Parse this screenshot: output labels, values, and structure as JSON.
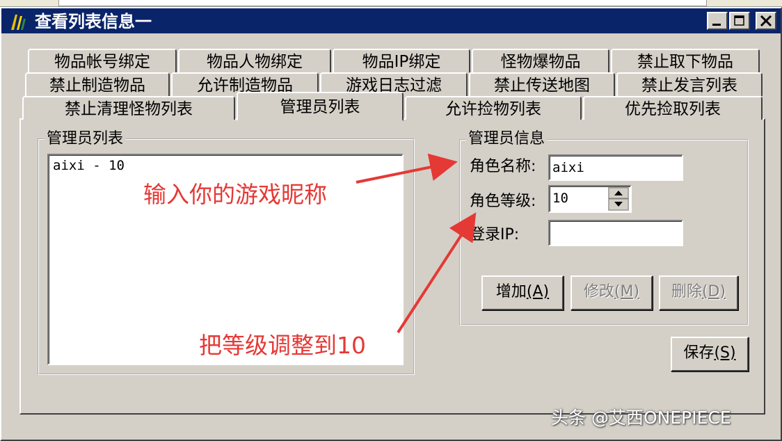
{
  "window": {
    "title": "查看列表信息一",
    "colors": {
      "titlebar": "#0a246a",
      "face": "#d4d0c8",
      "annotation": "#e53935"
    }
  },
  "tabs": {
    "row1": [
      "物品帐号绑定",
      "物品人物绑定",
      "物品IP绑定",
      "怪物爆物品",
      "禁止取下物品"
    ],
    "row2": [
      "禁止制造物品",
      "允许制造物品",
      "游戏日志过滤",
      "禁止传送地图",
      "禁止发言列表"
    ],
    "row3": [
      "禁止清理怪物列表",
      "管理员列表",
      "允许捡物列表",
      "优先捡取列表"
    ],
    "active": "管理员列表"
  },
  "admin_list": {
    "group_title": "管理员列表",
    "items": [
      "aixi - 10"
    ]
  },
  "admin_info": {
    "group_title": "管理员信息",
    "name_label": "角色名称:",
    "name_value": "aixi",
    "level_label": "角色等级:",
    "level_value": "10",
    "ip_label": "登录IP:",
    "ip_value": "",
    "add_label": "增加",
    "add_key": "(A)",
    "modify_label": "修改",
    "modify_key": "(M)",
    "delete_label": "删除",
    "delete_key": "(D)"
  },
  "save": {
    "label": "保存",
    "key": "(S)"
  },
  "annotations": {
    "name_hint": "输入你的游戏昵称",
    "level_hint": "把等级调整到10"
  },
  "watermark": "头条 @艾西ONEPIECE"
}
